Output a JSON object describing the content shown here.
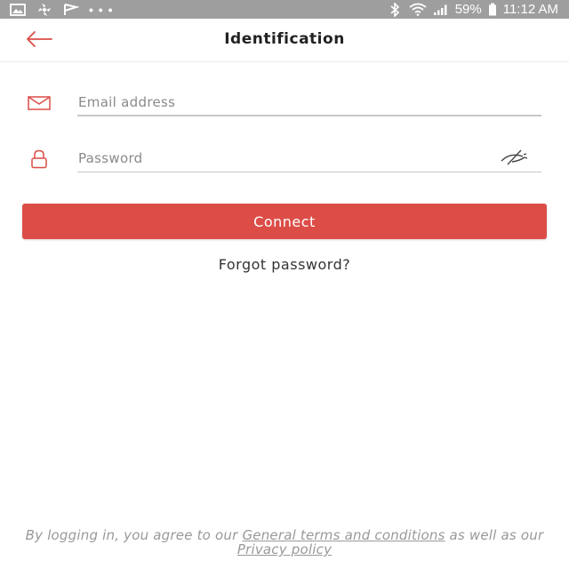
{
  "status_bar": {
    "notification_icons": [
      "gallery-icon",
      "pinwheel-icon",
      "flag-icon"
    ],
    "more_dots": "• • •",
    "battery": "59%",
    "time": "11:12 AM",
    "system_icons": [
      "bluetooth-icon",
      "wifi-icon",
      "signal-icon",
      "battery-icon"
    ]
  },
  "header": {
    "title": "Identification",
    "back_icon": "arrow-left-icon"
  },
  "form": {
    "email": {
      "placeholder": "Email address",
      "value": "",
      "icon": "envelope-icon"
    },
    "password": {
      "placeholder": "Password",
      "value": "",
      "icon": "lock-icon",
      "toggle_icon": "eye-off-icon"
    },
    "connect_label": "Connect",
    "forgot_label": "Forgot password?"
  },
  "legal": {
    "prefix": "By logging in, you agree to our ",
    "terms_link": "General terms and conditions",
    "middle": " as well as our ",
    "privacy_link": "Privacy policy"
  },
  "colors": {
    "accent": "#dc4d47",
    "status_bar": "#9e9e9e",
    "muted_text": "#999999"
  }
}
